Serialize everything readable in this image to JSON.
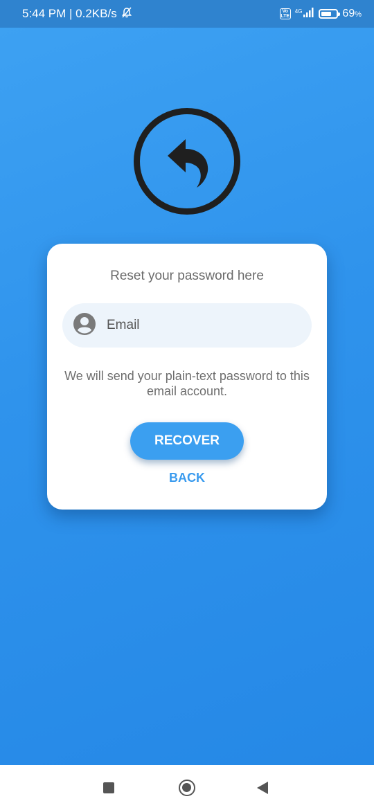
{
  "status_bar": {
    "time_and_speed": "5:44 PM | 0.2KB/s",
    "volte": "Vo LTE",
    "network": "4G",
    "battery_percent": "69",
    "battery_unit": "%",
    "battery_level": 0.69
  },
  "card": {
    "title": "Reset your password here",
    "email_placeholder": "Email",
    "info_text": "We will send your plain-text password to this email account.",
    "recover_label": "RECOVER",
    "back_label": "BACK"
  },
  "icons": {
    "logo": "reply-arrow-icon",
    "email": "account-circle-icon",
    "status": [
      "bell-off-icon",
      "volte-icon",
      "signal-icon",
      "battery-icon"
    ],
    "nav": [
      "recents-icon",
      "home-icon",
      "back-icon"
    ]
  },
  "colors": {
    "background": "#2f93ec",
    "status_bar": "#2f83cf",
    "accent": "#3b9ff0",
    "field_bg": "#edf4fb"
  }
}
